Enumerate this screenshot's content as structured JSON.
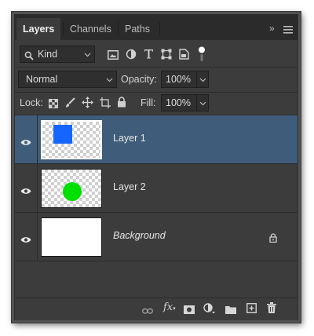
{
  "tabs": [
    {
      "label": "Layers",
      "active": true
    },
    {
      "label": "Channels",
      "active": false
    },
    {
      "label": "Paths",
      "active": false
    }
  ],
  "tab_overflow": "»",
  "filter": {
    "kind_label": "Kind",
    "icons": [
      "image-filter-icon",
      "adjustment-filter-icon",
      "type-filter-icon",
      "shape-filter-icon",
      "smart-object-filter-icon",
      "filter-toggle-icon"
    ]
  },
  "blend": {
    "mode": "Normal",
    "opacity_label": "Opacity:",
    "opacity_value": "100%"
  },
  "lock": {
    "label": "Lock:",
    "icons": [
      "lock-transparent-icon",
      "lock-image-icon",
      "lock-position-icon",
      "lock-artboard-icon",
      "lock-all-icon"
    ],
    "fill_label": "Fill:",
    "fill_value": "100%"
  },
  "layers": [
    {
      "name": "Layer 1",
      "selected": true,
      "visible": true,
      "thumb": "blue-square",
      "thumb_color": "#1565ff"
    },
    {
      "name": "Layer 2",
      "selected": false,
      "visible": true,
      "thumb": "green-circle",
      "thumb_color": "#00e000"
    },
    {
      "name": "Background",
      "selected": false,
      "visible": true,
      "thumb": "white",
      "italic": true,
      "locked": true
    }
  ],
  "footer_icons": [
    "link-layers-icon",
    "fx-icon",
    "add-mask-icon",
    "adjustment-layer-icon",
    "new-group-icon",
    "new-layer-icon",
    "delete-icon"
  ],
  "colors": {
    "panel_bg": "#3c3c3c",
    "tab_bar_bg": "#2b2b2b",
    "selection": "#3f5d7a"
  }
}
